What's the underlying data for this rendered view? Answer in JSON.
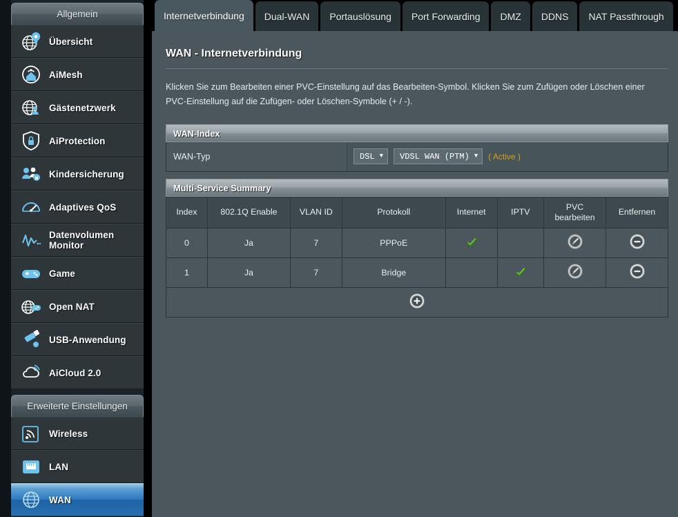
{
  "sidebar": {
    "groups": [
      {
        "header": "Allgemein",
        "items": [
          {
            "label": "Übersicht",
            "icon": "globe-pin-icon",
            "active": false
          },
          {
            "label": "AiMesh",
            "icon": "mesh-house-icon",
            "active": false
          },
          {
            "label": "Gästenetzwerk",
            "icon": "globe-users-icon",
            "active": false
          },
          {
            "label": "AiProtection",
            "icon": "shield-lock-icon",
            "active": false
          },
          {
            "label": "Kindersicherung",
            "icon": "parental-users-icon",
            "active": false
          },
          {
            "label": "Adaptives QoS",
            "icon": "gauge-icon",
            "active": false
          },
          {
            "label": "Datenvolumen Monitor",
            "icon": "waveform-icon",
            "active": false
          },
          {
            "label": "Game",
            "icon": "gamepad-icon",
            "active": false
          },
          {
            "label": "Open NAT",
            "icon": "globe-gamepad-icon",
            "active": false
          },
          {
            "label": "USB-Anwendung",
            "icon": "usb-icon",
            "active": false
          },
          {
            "label": "AiCloud 2.0",
            "icon": "cloud-icon",
            "active": false
          }
        ]
      },
      {
        "header": "Erweiterte Einstellungen",
        "items": [
          {
            "label": "Wireless",
            "icon": "wifi-icon",
            "active": false
          },
          {
            "label": "LAN",
            "icon": "ethernet-port-icon",
            "active": false
          },
          {
            "label": "WAN",
            "icon": "globe-icon",
            "active": true
          }
        ]
      }
    ]
  },
  "tabs": [
    {
      "label": "Internetverbindung",
      "active": true
    },
    {
      "label": "Dual-WAN",
      "active": false
    },
    {
      "label": "Portauslösung",
      "active": false
    },
    {
      "label": "Port Forwarding",
      "active": false
    },
    {
      "label": "DMZ",
      "active": false
    },
    {
      "label": "DDNS",
      "active": false
    },
    {
      "label": "NAT Passthrough",
      "active": false
    }
  ],
  "main": {
    "title": "WAN - Internetverbindung",
    "description": "Klicken Sie zum Bearbeiten einer PVC-Einstellung auf das Bearbeiten-Symbol. Klicken Sie zum Zufügen oder Löschen einer PVC-Einstellung auf die Zufügen- oder Löschen-Symbole (+ / -).",
    "wan_index": {
      "panel_title": "WAN-Index",
      "row_label": "WAN-Typ",
      "select_type": "DSL",
      "select_interface": "VDSL WAN (PTM)",
      "status_note": "( Active )"
    },
    "multi_service": {
      "panel_title": "Multi-Service Summary",
      "columns": [
        "Index",
        "802.1Q Enable",
        "VLAN ID",
        "Protokoll",
        "Internet",
        "IPTV",
        "PVC bearbeiten",
        "Entfernen"
      ],
      "rows": [
        {
          "index": "0",
          "dot1q": "Ja",
          "vlan": "7",
          "protocol": "PPPoE",
          "internet": true,
          "iptv": false
        },
        {
          "index": "1",
          "dot1q": "Ja",
          "vlan": "7",
          "protocol": "Bridge",
          "internet": false,
          "iptv": true
        }
      ],
      "add_label": "+"
    }
  },
  "colors": {
    "accent_blue": "#2e7bc0",
    "content_bg": "#4b575c",
    "panel_header": "#8b9499",
    "active_note": "#d9a11c",
    "check_green": "#46a11b"
  }
}
